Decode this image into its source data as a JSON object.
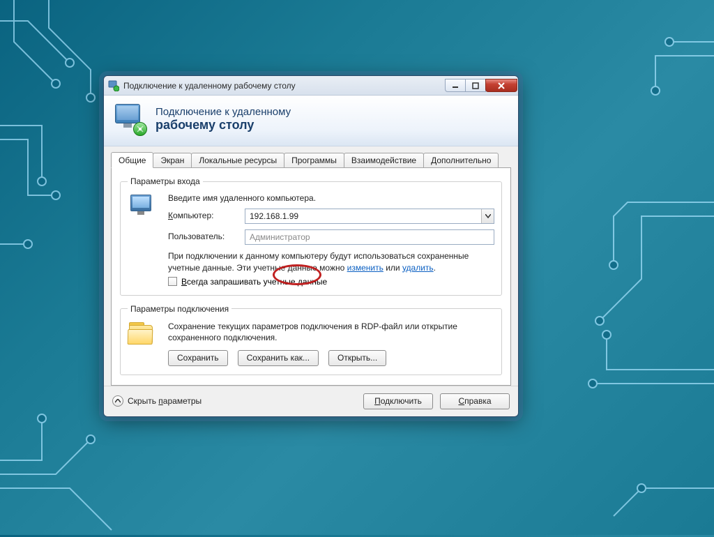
{
  "window": {
    "title": "Подключение к удаленному рабочему столу"
  },
  "banner": {
    "line1": "Подключение к удаленному",
    "line2": "рабочему столу"
  },
  "tabs": {
    "general": "Общие",
    "display": "Экран",
    "local_resources": "Локальные ресурсы",
    "programs": "Программы",
    "experience": "Взаимодействие",
    "advanced": "Дополнительно"
  },
  "login_group": {
    "legend": "Параметры входа",
    "prompt": "Введите имя удаленного компьютера.",
    "computer_label": "Компьютер:",
    "computer_value": "192.168.1.99",
    "user_label": "Пользователь:",
    "user_value": "Администратор",
    "info_before": "При подключении к данному компьютеру будут использоваться сохраненные учетные данные. Эти учетные данные можно ",
    "link_change": "изменить",
    "info_middle": " или ",
    "link_delete": "удалить",
    "info_after": ".",
    "always_ask": "Всегда запрашивать учетные данные"
  },
  "conn_group": {
    "legend": "Параметры подключения",
    "text": "Сохранение текущих параметров подключения в RDP-файл или открытие сохраненного подключения.",
    "save": "Сохранить",
    "save_as": "Сохранить как...",
    "open": "Открыть..."
  },
  "footer": {
    "hide_params": "Скрыть параметры",
    "connect": "Подключить",
    "help": "Справка"
  }
}
